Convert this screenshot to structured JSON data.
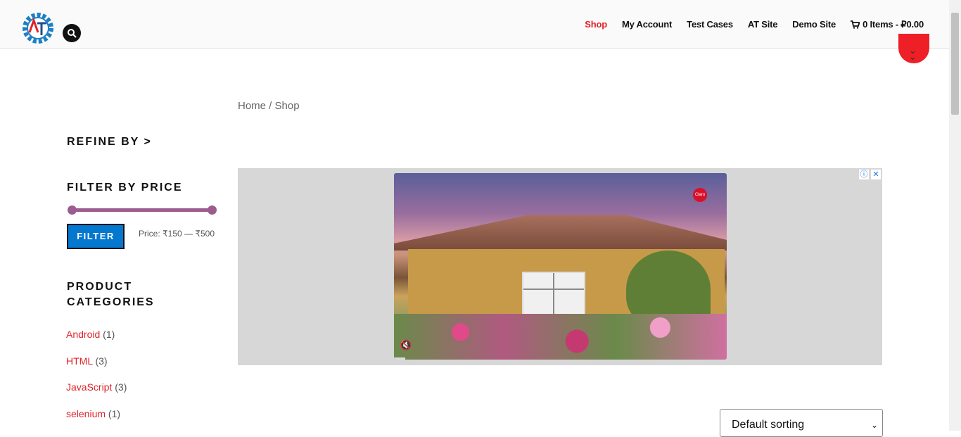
{
  "header": {
    "nav": [
      {
        "label": "Shop",
        "active": true
      },
      {
        "label": "My Account",
        "active": false
      },
      {
        "label": "Test Cases",
        "active": false
      },
      {
        "label": "AT Site",
        "active": false
      },
      {
        "label": "Demo Site",
        "active": false
      }
    ],
    "cart_label": "0 Items - ₽0.00",
    "icons": [
      "site-logo",
      "search-icon",
      "cart-icon",
      "scroll-down-icon"
    ]
  },
  "breadcrumb": {
    "home": "Home",
    "separator": " / ",
    "current": "Shop"
  },
  "sidebar": {
    "refine_heading": "REFINE BY >",
    "price_heading": "FILTER BY PRICE",
    "filter_button": "FILTER",
    "price_range": "Price: ₹150 — ₹500",
    "categories_heading_line1": "PRODUCT",
    "categories_heading_line2": "CATEGORIES",
    "categories": [
      {
        "name": "Android",
        "count": "(1)"
      },
      {
        "name": "HTML",
        "count": "(3)"
      },
      {
        "name": "JavaScript",
        "count": "(3)"
      },
      {
        "name": "selenium",
        "count": "(1)"
      }
    ]
  },
  "ad": {
    "controls": [
      "ⓘ",
      "✕"
    ],
    "brand": "Claro"
  },
  "sorting": {
    "selected": "Default sorting"
  },
  "colors": {
    "accent": "#e0232a",
    "button": "#0478cf",
    "slider": "#9b5c8f"
  }
}
